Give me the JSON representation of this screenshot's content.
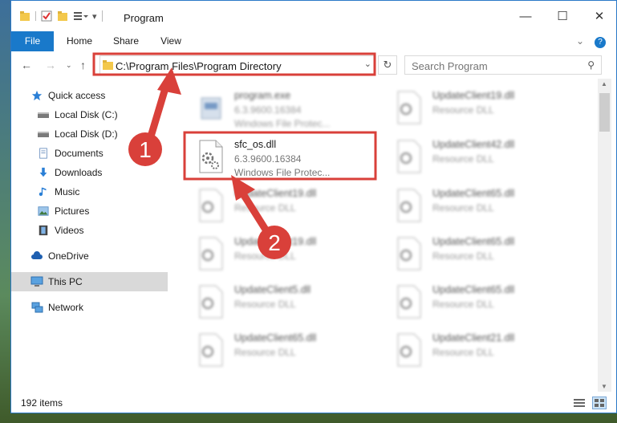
{
  "window": {
    "title": "Program",
    "minimize": "—",
    "maximize": "☐",
    "close": "✕"
  },
  "ribbon": {
    "tabs": [
      "File",
      "Home",
      "Share",
      "View"
    ],
    "expand": "⌄",
    "help": "?"
  },
  "address": {
    "path": "C:\\Program Files\\Program Directory",
    "search_placeholder": "Search Program"
  },
  "nav": {
    "items": [
      {
        "label": "Quick access",
        "icon": "star-icon"
      },
      {
        "label": "Local Disk (C:)",
        "icon": "drive-icon"
      },
      {
        "label": "Local Disk (D:)",
        "icon": "drive-icon"
      },
      {
        "label": "Documents",
        "icon": "documents-icon"
      },
      {
        "label": "Downloads",
        "icon": "download-icon"
      },
      {
        "label": "Music",
        "icon": "music-icon"
      },
      {
        "label": "Pictures",
        "icon": "pictures-icon"
      },
      {
        "label": "Videos",
        "icon": "videos-icon"
      },
      {
        "label": "OneDrive",
        "icon": "cloud-icon"
      },
      {
        "label": "This PC",
        "icon": "computer-icon"
      },
      {
        "label": "Network",
        "icon": "network-icon"
      }
    ]
  },
  "files": {
    "left": [
      {
        "name": "program.exe",
        "version": "6.3.9600.16384",
        "desc": "Windows File Protec..."
      },
      {
        "name": "sfc_os.dll",
        "version": "6.3.9600.16384",
        "desc": "Windows File Protec..."
      },
      {
        "name": "UpdateClient19.dll",
        "version": "Resource DLL",
        "desc": ""
      },
      {
        "name": "UpdateClient19.dll",
        "version": "Resource DLL",
        "desc": ""
      },
      {
        "name": "UpdateClient5.dll",
        "version": "Resource DLL",
        "desc": ""
      },
      {
        "name": "UpdateClient65.dll",
        "version": "Resource DLL",
        "desc": ""
      }
    ],
    "right": [
      {
        "name": "UpdateClient19.dll",
        "version": "Resource DLL"
      },
      {
        "name": "UpdateClient42.dll",
        "version": "Resource DLL"
      },
      {
        "name": "UpdateClient65.dll",
        "version": "Resource DLL"
      },
      {
        "name": "UpdateClient65.dll",
        "version": "Resource DLL"
      },
      {
        "name": "UpdateClient65.dll",
        "version": "Resource DLL"
      },
      {
        "name": "UpdateClient21.dll",
        "version": "Resource DLL"
      }
    ]
  },
  "status": {
    "count": "192 items"
  },
  "annotations": {
    "step1": "1",
    "step2": "2",
    "color": "#d9403a"
  }
}
